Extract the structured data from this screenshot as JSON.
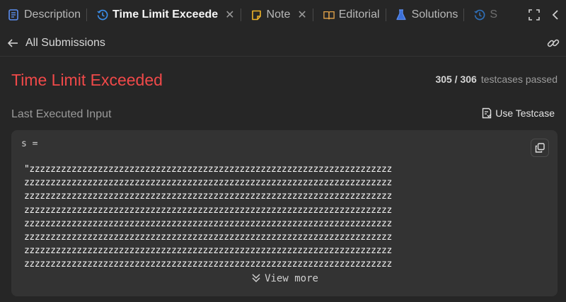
{
  "tabs": [
    {
      "label": "Description",
      "icon": "description-icon",
      "active": false,
      "closable": false
    },
    {
      "label": "Time Limit Exceede",
      "icon": "history-icon",
      "active": true,
      "closable": true
    },
    {
      "label": "Note",
      "icon": "note-icon",
      "active": false,
      "closable": true
    },
    {
      "label": "Editorial",
      "icon": "book-icon",
      "active": false,
      "closable": false
    },
    {
      "label": "Solutions",
      "icon": "flask-icon",
      "active": false,
      "closable": false
    },
    {
      "label": "S",
      "icon": "history-icon",
      "active": false,
      "closable": false
    }
  ],
  "subbar": {
    "back_label": "All Submissions"
  },
  "result": {
    "status": "Time Limit Exceeded",
    "passed": "305 / 306",
    "passed_suffix": "testcases passed"
  },
  "last_input": {
    "heading": "Last Executed Input",
    "use_testcase": "Use Testcase",
    "variable": "s =",
    "lines": [
      "\"zzzzzzzzzzzzzzzzzzzzzzzzzzzzzzzzzzzzzzzzzzzzzzzzzzzzzzzzzzzzzzzzzzzzz",
      "zzzzzzzzzzzzzzzzzzzzzzzzzzzzzzzzzzzzzzzzzzzzzzzzzzzzzzzzzzzzzzzzzzzzzz",
      "zzzzzzzzzzzzzzzzzzzzzzzzzzzzzzzzzzzzzzzzzzzzzzzzzzzzzzzzzzzzzzzzzzzzzz",
      "zzzzzzzzzzzzzzzzzzzzzzzzzzzzzzzzzzzzzzzzzzzzzzzzzzzzzzzzzzzzzzzzzzzzzz",
      "zzzzzzzzzzzzzzzzzzzzzzzzzzzzzzzzzzzzzzzzzzzzzzzzzzzzzzzzzzzzzzzzzzzzzz",
      "zzzzzzzzzzzzzzzzzzzzzzzzzzzzzzzzzzzzzzzzzzzzzzzzzzzzzzzzzzzzzzzzzzzzzz",
      "zzzzzzzzzzzzzzzzzzzzzzzzzzzzzzzzzzzzzzzzzzzzzzzzzzzzzzzzzzzzzzzzzzzzzz",
      "zzzzzzzzzzzzzzzzzzzzzzzzzzzzzzzzzzzzzzzzzzzzzzzzzzzzzzzzzzzzzzzzzzzzzz"
    ],
    "view_more": "View more"
  },
  "colors": {
    "error": "#f04949",
    "accent_blue": "#3b8eea",
    "note_yellow": "#f0b429",
    "editorial_orange": "#e3a34a"
  }
}
